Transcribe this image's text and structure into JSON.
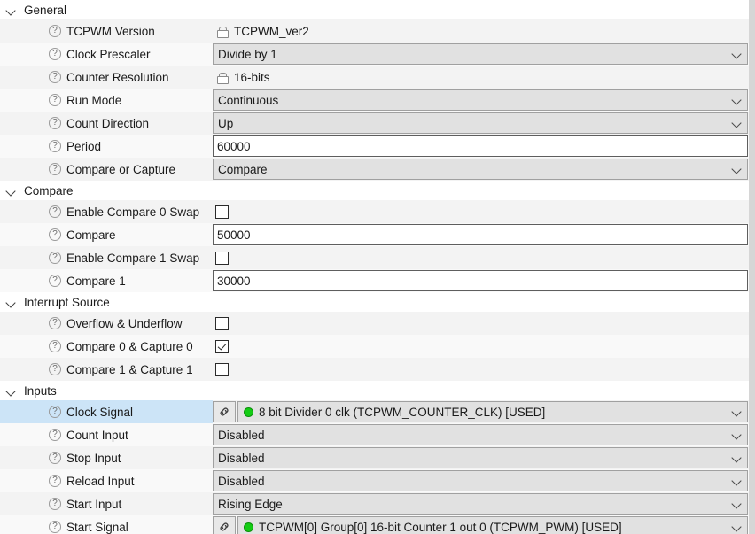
{
  "sections": [
    {
      "name": "General",
      "rows": [
        {
          "label": "TCPWM Version",
          "icon": "help-icon",
          "control": "locked",
          "value": "TCPWM_ver2"
        },
        {
          "label": "Clock Prescaler",
          "icon": "help-icon",
          "control": "dropdown",
          "value": "Divide by 1"
        },
        {
          "label": "Counter Resolution",
          "icon": "help-icon",
          "control": "locked",
          "value": "16-bits"
        },
        {
          "label": "Run Mode",
          "icon": "help-icon",
          "control": "dropdown",
          "value": "Continuous"
        },
        {
          "label": "Count Direction",
          "icon": "help-icon",
          "control": "dropdown",
          "value": "Up"
        },
        {
          "label": "Period",
          "icon": "help-icon",
          "control": "text",
          "value": "60000"
        },
        {
          "label": "Compare or Capture",
          "icon": "help-icon",
          "control": "dropdown",
          "value": "Compare"
        }
      ]
    },
    {
      "name": "Compare",
      "rows": [
        {
          "label": "Enable Compare 0 Swap",
          "icon": "help-icon",
          "control": "checkbox",
          "checked": false
        },
        {
          "label": "Compare",
          "icon": "help-icon",
          "control": "text",
          "value": "50000"
        },
        {
          "label": "Enable Compare 1 Swap",
          "icon": "help-icon",
          "control": "checkbox",
          "checked": false
        },
        {
          "label": "Compare 1",
          "icon": "help-icon",
          "control": "text",
          "value": "30000"
        }
      ]
    },
    {
      "name": "Interrupt Source",
      "rows": [
        {
          "label": "Overflow & Underflow",
          "icon": "help-icon",
          "control": "checkbox",
          "checked": false
        },
        {
          "label": "Compare 0 & Capture 0",
          "icon": "help-icon",
          "control": "checkbox",
          "checked": true
        },
        {
          "label": "Compare 1 & Capture 1",
          "icon": "help-icon",
          "control": "checkbox",
          "checked": false
        }
      ]
    },
    {
      "name": "Inputs",
      "rows": [
        {
          "label": "Clock Signal",
          "icon": "help-icon",
          "control": "signal",
          "value": "8 bit Divider 0 clk (TCPWM_COUNTER_CLK) [USED]",
          "selected": true
        },
        {
          "label": "Count Input",
          "icon": "help-icon",
          "control": "dropdown",
          "value": "Disabled"
        },
        {
          "label": "Stop Input",
          "icon": "help-icon",
          "control": "dropdown",
          "value": "Disabled"
        },
        {
          "label": "Reload Input",
          "icon": "help-icon",
          "control": "dropdown",
          "value": "Disabled"
        },
        {
          "label": "Start Input",
          "icon": "help-icon",
          "control": "dropdown",
          "value": "Rising Edge"
        },
        {
          "label": "Start Signal",
          "icon": "help-icon",
          "control": "signal",
          "value": "TCPWM[0] Group[0] 16-bit Counter 1 out 0 (TCPWM_PWM) [USED]"
        }
      ]
    }
  ],
  "glyphs": {
    "help": "?",
    "section_chevron": "chevron-down-icon",
    "combo_chevron": "chevron-down-icon",
    "lock": "lock-icon",
    "link": "chain-link-icon",
    "status_dot": "green-status-dot"
  },
  "colors": {
    "selection": "#cce4f7",
    "row_bg": "#f3f3f3",
    "row_bg_alt": "#f9f9f9",
    "combo_bg": "#e1e1e1",
    "status_green": "#14cc14",
    "border": "#a0a0a0"
  }
}
